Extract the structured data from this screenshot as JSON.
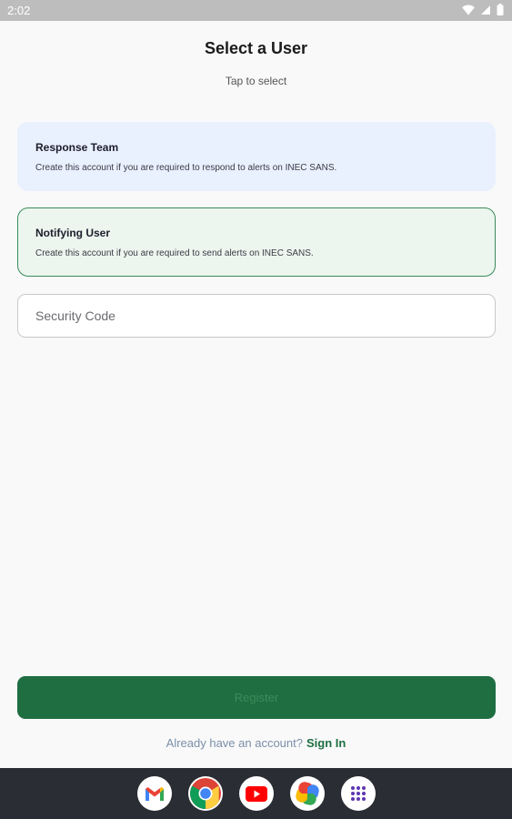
{
  "status_bar": {
    "time": "2:02"
  },
  "header": {
    "title": "Select a User",
    "subtitle": "Tap to select"
  },
  "user_types": [
    {
      "title": "Response Team",
      "description": "Create this account if you are required to respond to alerts on INEC SANS."
    },
    {
      "title": "Notifying User",
      "description": "Create this account if you are required to send alerts on INEC SANS."
    }
  ],
  "security_code": {
    "placeholder": "Security Code",
    "value": ""
  },
  "register": {
    "label": "Register"
  },
  "footer": {
    "prompt": "Already have an account?",
    "link": "Sign In"
  },
  "dock": {
    "apps": [
      "gmail-icon",
      "chrome-icon",
      "youtube-icon",
      "photos-icon",
      "app-drawer-icon"
    ]
  },
  "colors": {
    "accent_green": "#1e6e42",
    "response_card_bg": "#e9f0fe",
    "notify_card_bg": "#ecf6ef",
    "notify_card_border": "#3a8a58"
  }
}
